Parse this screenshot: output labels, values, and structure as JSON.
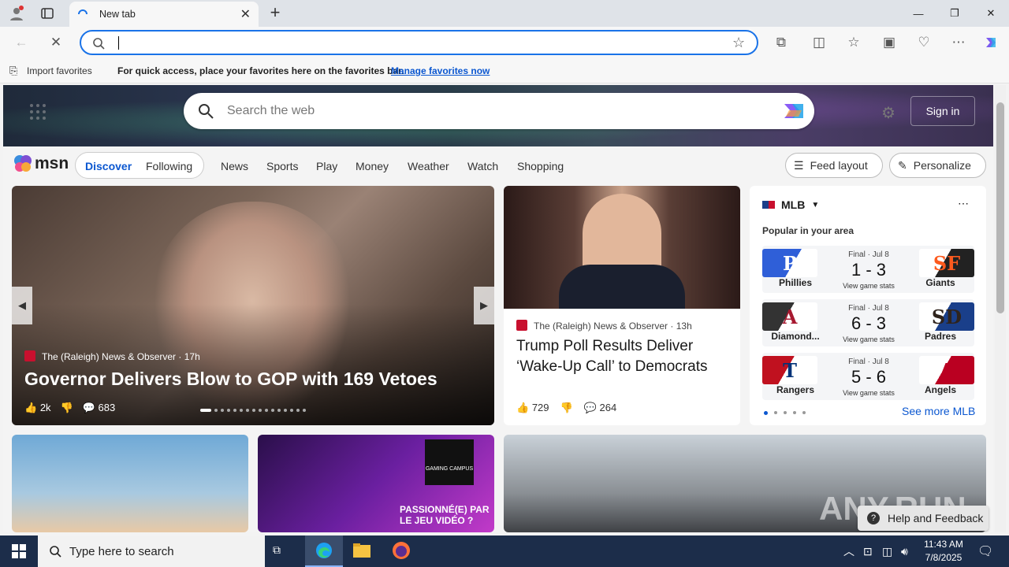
{
  "browser": {
    "tab_title": "New tab",
    "omnibox_value": "",
    "favbar": {
      "import_label": "Import favorites",
      "hint": "For quick access, place your favorites here on the favorites bar.",
      "manage_link": "Manage favorites now"
    }
  },
  "msn": {
    "search_placeholder": "Search the web",
    "sign_in": "Sign in",
    "logo_text": "msn",
    "tabs": [
      "Discover",
      "Following"
    ],
    "nav": [
      "News",
      "Sports",
      "Play",
      "Money",
      "Weather",
      "Watch",
      "Shopping"
    ],
    "feed_layout": "Feed layout",
    "personalize": "Personalize",
    "hero_story": {
      "source": "The (Raleigh) News & Observer",
      "age": "17h",
      "headline": "Governor Delivers Blow to GOP with 169 Vetoes",
      "likes": "2k",
      "comments": "683"
    },
    "story2": {
      "source": "The (Raleigh) News & Observer",
      "age": "13h",
      "headline": "Trump Poll Results Deliver ‘Wake-Up Call’ to Democrats",
      "likes": "729",
      "comments": "264"
    },
    "mlb": {
      "title": "MLB",
      "subtitle": "Popular in your area",
      "see_more": "See more MLB",
      "games": [
        {
          "status": "Final · Jul 8",
          "home": "Phillies",
          "away": "Giants",
          "score": "1 - 3",
          "stats": "View game stats",
          "home_color": "#2f5fd8",
          "away_color": "#fd5a1e"
        },
        {
          "status": "Final · Jul 8",
          "home": "Diamond...",
          "away": "Padres",
          "score": "6 - 3",
          "stats": "View game stats",
          "home_color": "#a71930",
          "away_color": "#2f241d"
        },
        {
          "status": "Final · Jul 8",
          "home": "Rangers",
          "away": "Angels",
          "score": "5 - 6",
          "stats": "View game stats",
          "home_color": "#c0111f",
          "away_color": "#ba0021"
        }
      ]
    },
    "promo_text": "PASSIONNÉ(E) PAR LE JEU VIDÉO ?",
    "promo_brand": "GAMING CAMPUS",
    "help_feedback": "Help and Feedback"
  },
  "taskbar": {
    "search_placeholder": "Type here to search",
    "time": "11:43 AM",
    "date": "7/8/2025"
  },
  "watermark": "ANY.RUN"
}
